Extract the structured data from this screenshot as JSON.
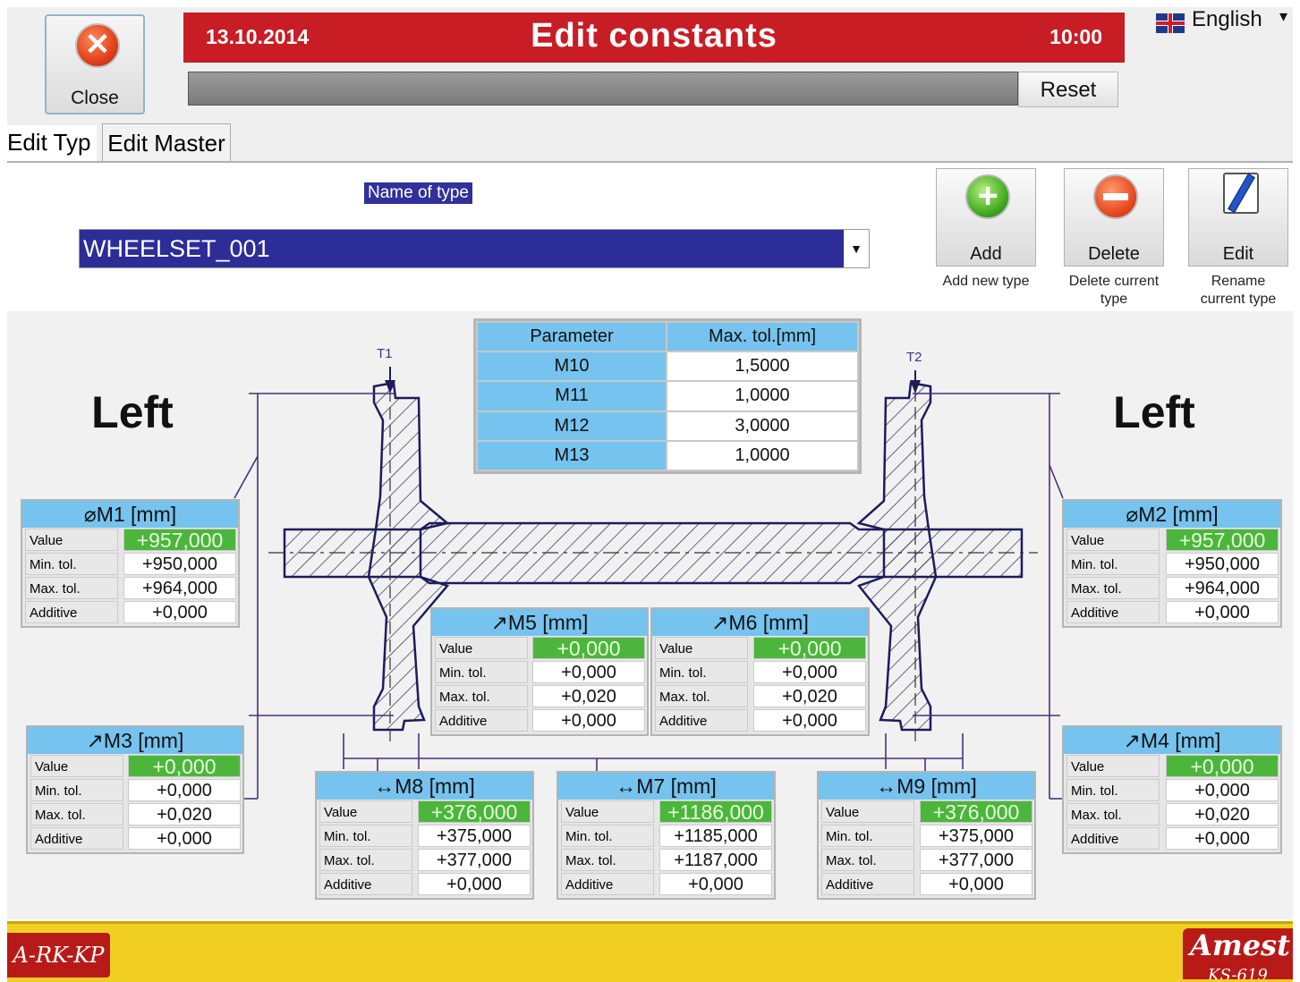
{
  "header": {
    "close_label": "Close",
    "date": "13.10.2014",
    "title": "Edit constants",
    "time": "10:00",
    "language": "English",
    "reset_label": "Reset"
  },
  "tabs": [
    {
      "label": "Edit Typ"
    },
    {
      "label": "Edit Master"
    }
  ],
  "form": {
    "name_label": "Name of type",
    "type_value": "WHEELSET_001"
  },
  "actions": {
    "add": {
      "label": "Add",
      "caption": "Add new type"
    },
    "delete": {
      "label": "Delete",
      "caption_line1": "Delete current",
      "caption_line2": "type"
    },
    "edit": {
      "label": "Edit",
      "caption_line1": "Rename",
      "caption_line2": "current type"
    }
  },
  "side_labels": {
    "left_1": "Left",
    "left_2": "Left"
  },
  "markers": {
    "t1": "T1",
    "t2": "T2"
  },
  "param_table": {
    "headers": [
      "Parameter",
      "Max. tol.[mm]"
    ],
    "rows": [
      {
        "param": "M10",
        "value": "1,5000"
      },
      {
        "param": "M11",
        "value": "1,0000"
      },
      {
        "param": "M12",
        "value": "3,0000"
      },
      {
        "param": "M13",
        "value": "1,0000"
      }
    ]
  },
  "row_labels": {
    "value": "Value",
    "min": "Min. tol.",
    "max": "Max. tol.",
    "additive": "Additive"
  },
  "measurements": {
    "m1": {
      "title": "⌀M1 [mm]",
      "value": "+957,000",
      "min": "+950,000",
      "max": "+964,000",
      "additive": "+0,000"
    },
    "m2": {
      "title": "⌀M2 [mm]",
      "value": "+957,000",
      "min": "+950,000",
      "max": "+964,000",
      "additive": "+0,000"
    },
    "m3": {
      "title": "↗M3 [mm]",
      "value": "+0,000",
      "min": "+0,000",
      "max": "+0,020",
      "additive": "+0,000"
    },
    "m4": {
      "title": "↗M4 [mm]",
      "value": "+0,000",
      "min": "+0,000",
      "max": "+0,020",
      "additive": "+0,000"
    },
    "m5": {
      "title": "↗M5 [mm]",
      "value": "+0,000",
      "min": "+0,000",
      "max": "+0,020",
      "additive": "+0,000"
    },
    "m6": {
      "title": "↗M6 [mm]",
      "value": "+0,000",
      "min": "+0,000",
      "max": "+0,020",
      "additive": "+0,000"
    },
    "m7": {
      "title": "↔M7 [mm]",
      "value": "+1186,000",
      "min": "+1185,000",
      "max": "+1187,000",
      "additive": "+0,000"
    },
    "m8": {
      "title": "↔M8 [mm]",
      "value": "+376,000",
      "min": "+375,000",
      "max": "+377,000",
      "additive": "+0,000"
    },
    "m9": {
      "title": "↔M9 [mm]",
      "value": "+376,000",
      "min": "+375,000",
      "max": "+377,000",
      "additive": "+0,000"
    }
  },
  "footer": {
    "logo_left": "A-RK-KP",
    "logo_right_line1": "Amest",
    "logo_right_line2": "KS-619"
  },
  "colors": {
    "title_bar": "#c81d25",
    "header_cell": "#75c3ee",
    "value_green": "#4cb63c",
    "select_blue": "#2c2d96",
    "footer_yellow": "#f0cf22"
  }
}
